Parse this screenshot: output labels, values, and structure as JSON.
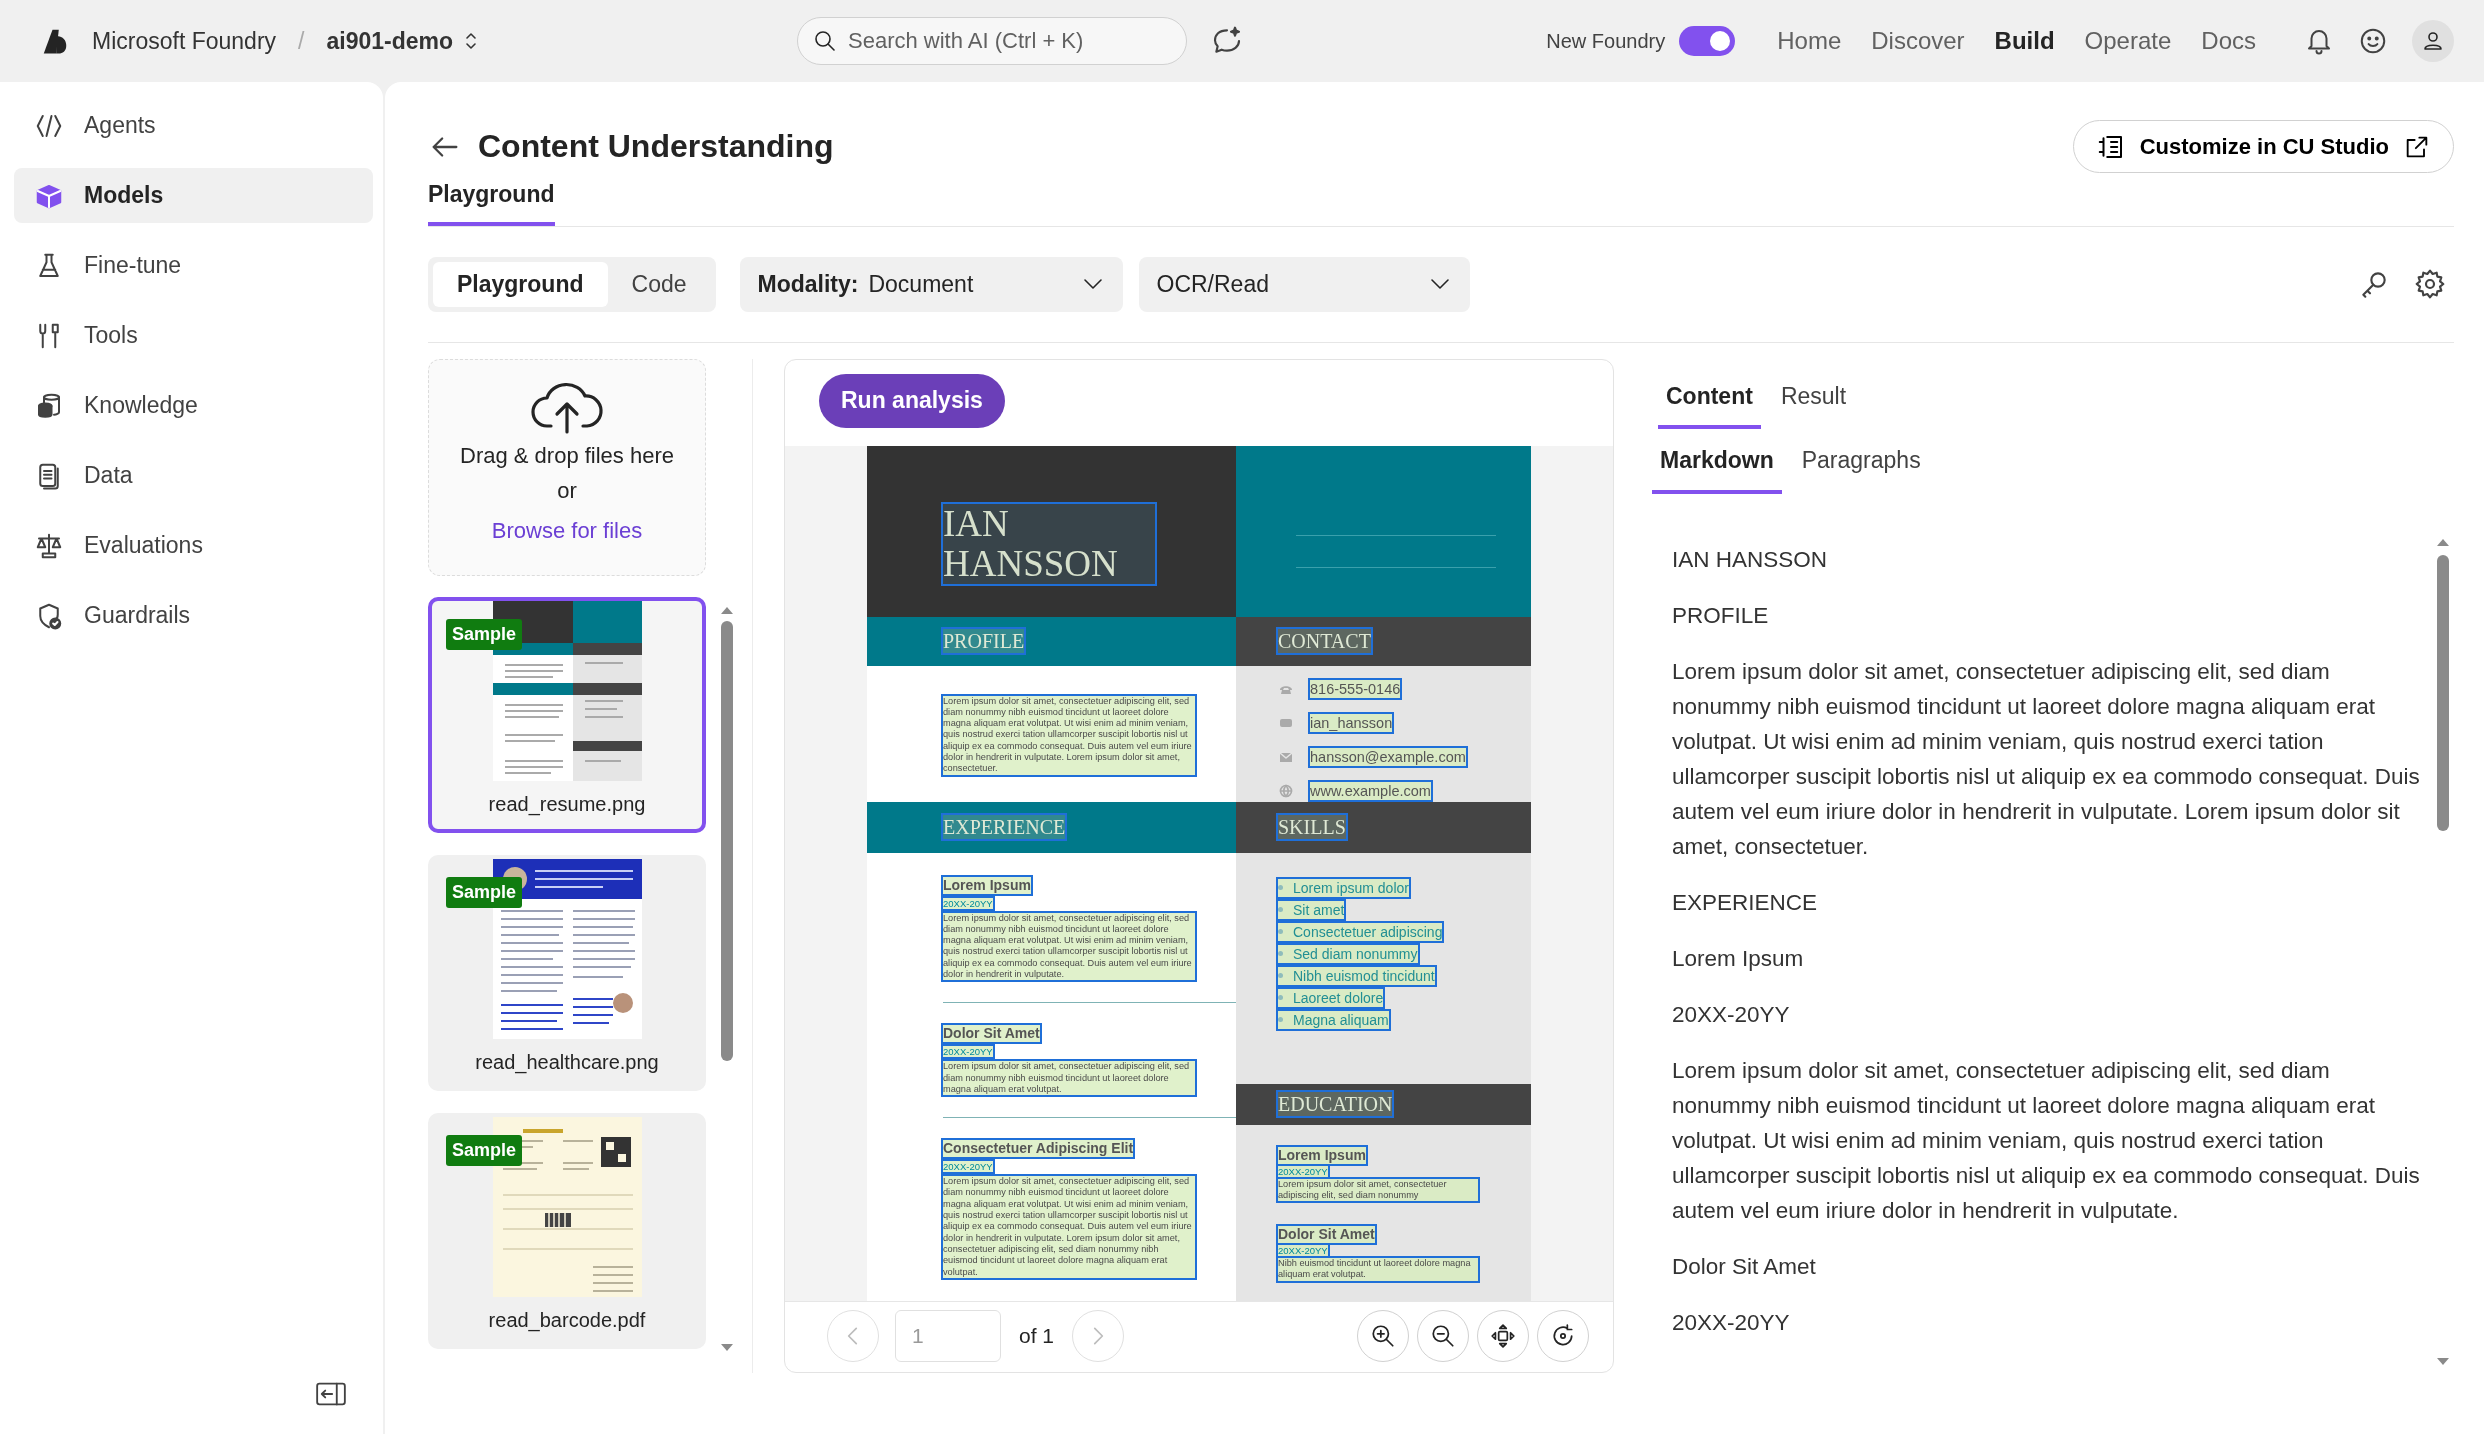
{
  "topbar": {
    "brand": "Microsoft Foundry",
    "separator": "/",
    "project": "ai901-demo",
    "search": {
      "placeholder": "Search with AI (Ctrl + K)"
    },
    "toggle": {
      "label": "New Foundry",
      "on": true
    },
    "nav": [
      {
        "label": "Home",
        "selected": false
      },
      {
        "label": "Discover",
        "selected": false
      },
      {
        "label": "Build",
        "selected": true
      },
      {
        "label": "Operate",
        "selected": false
      },
      {
        "label": "Docs",
        "selected": false
      }
    ]
  },
  "sidebar": {
    "items": [
      {
        "label": "Agents",
        "selected": false
      },
      {
        "label": "Models",
        "selected": true
      },
      {
        "label": "Fine-tune",
        "selected": false
      },
      {
        "label": "Tools",
        "selected": false
      },
      {
        "label": "Knowledge",
        "selected": false
      },
      {
        "label": "Data",
        "selected": false
      },
      {
        "label": "Evaluations",
        "selected": false
      },
      {
        "label": "Guardrails",
        "selected": false
      }
    ]
  },
  "page": {
    "title": "Content Understanding",
    "tabs": [
      {
        "label": "Playground",
        "selected": true
      }
    ],
    "action": "Customize in CU Studio"
  },
  "toolbar": {
    "segments": [
      {
        "label": "Playground",
        "selected": true
      },
      {
        "label": "Code",
        "selected": false
      }
    ],
    "dropdowns": [
      {
        "label": "Modality:",
        "value": "Document"
      },
      {
        "value": "OCR/Read"
      }
    ]
  },
  "files": {
    "upload": {
      "text": "Drag & drop files here",
      "or": "or",
      "link": "Browse for files"
    },
    "items": [
      {
        "name": "read_resume.png",
        "badge": "Sample",
        "selected": true,
        "kind": "resume"
      },
      {
        "name": "read_healthcare.png",
        "badge": "Sample",
        "selected": false,
        "kind": "article"
      },
      {
        "name": "read_barcode.pdf",
        "badge": "Sample",
        "selected": false,
        "kind": "invoice"
      }
    ]
  },
  "preview": {
    "run_button": "Run analysis",
    "pager": {
      "page": "1",
      "of": "of 1"
    },
    "document": {
      "name_lines": [
        "IAN",
        "HANSSON"
      ],
      "profile": {
        "heading": "PROFILE",
        "text": "Lorem ipsum dolor sit amet, consectetuer adipiscing elit, sed diam nonummy nibh euismod tincidunt ut laoreet dolore magna aliquam erat volutpat. Ut wisi enim ad minim veniam, quis nostrud exerci tation ullamcorper suscipit lobortis nisl ut aliquip ex ea commodo consequat. Duis autem vel eum iriure dolor in hendrerit in vulputate. Lorem ipsum dolor sit amet, consectetuer."
      },
      "contact": {
        "heading": "CONTACT",
        "items": [
          "816-555-0146",
          "ian_hansson",
          "hansson@example.com",
          "www.example.com"
        ]
      },
      "experience": {
        "heading": "EXPERIENCE",
        "items": [
          {
            "title": "Lorem Ipsum",
            "dates": "20XX-20YY",
            "text": "Lorem ipsum dolor sit amet, consectetuer adipiscing elit, sed diam nonummy nibh euismod tincidunt ut laoreet dolore magna aliquam erat volutpat. Ut wisi enim ad minim veniam, quis nostrud exerci tation ullamcorper suscipit lobortis nisl ut aliquip ex ea commodo consequat. Duis autem vel eum iriure dolor in hendrerit in vulputate."
          },
          {
            "title": "Dolor Sit Amet",
            "dates": "20XX-20YY",
            "text": "Lorem ipsum dolor sit amet, consectetuer adipiscing elit, sed diam nonummy nibh euismod tincidunt ut laoreet dolore magna aliquam erat volutpat."
          },
          {
            "title": "Consectetuer Adipiscing Elit",
            "dates": "20XX-20YY",
            "text": "Lorem ipsum dolor sit amet, consectetuer adipiscing elit, sed diam nonummy nibh euismod tincidunt ut laoreet dolore magna aliquam erat volutpat. Ut wisi enim ad minim veniam, quis nostrud exerci tation ullamcorper suscipit lobortis nisl ut aliquip ex ea commodo consequat. Duis autem vel eum iriure dolor in hendrerit in vulputate. Lorem ipsum dolor sit amet, consectetuer adipiscing elit, sed diam nonummy nibh euismod tincidunt ut laoreet dolore magna aliquam erat volutpat."
          }
        ]
      },
      "skills": {
        "heading": "SKILLS",
        "items": [
          "Lorem ipsum dolor",
          "Sit amet",
          "Consectetuer adipiscing",
          "Sed diam nonummy",
          "Nibh euismod tincidunt",
          "Laoreet dolore",
          "Magna aliquam"
        ]
      },
      "education": {
        "heading": "EDUCATION",
        "items": [
          {
            "title": "Lorem Ipsum",
            "dates": "20XX-20YY",
            "text": "Lorem ipsum dolor sit amet, consectetuer adipiscing elit, sed diam nonummy"
          },
          {
            "title": "Dolor Sit Amet",
            "dates": "20XX-20YY",
            "text": "Nibh euismod tincidunt ut laoreet dolore magna aliquam erat volutpat."
          }
        ]
      }
    }
  },
  "results": {
    "tabs": [
      {
        "label": "Content",
        "selected": true
      },
      {
        "label": "Result",
        "selected": false
      }
    ],
    "subtabs": [
      {
        "label": "Markdown",
        "selected": true
      },
      {
        "label": "Paragraphs",
        "selected": false
      }
    ],
    "lines": [
      "IAN HANSSON",
      "PROFILE",
      "Lorem ipsum dolor sit amet, consectetuer adipiscing elit, sed diam nonummy nibh euismod tincidunt ut laoreet dolore magna aliquam erat volutpat. Ut wisi enim ad minim veniam, quis nostrud exerci tation ullamcorper suscipit lobortis nisl ut aliquip ex ea commodo consequat. Duis autem vel eum iriure dolor in hendrerit in vulputate. Lorem ipsum dolor sit amet, consectetuer.",
      "EXPERIENCE",
      "Lorem Ipsum",
      "20XX-20YY",
      "Lorem ipsum dolor sit amet, consectetuer adipiscing elit, sed diam nonummy nibh euismod tincidunt ut laoreet dolore magna aliquam erat volutpat. Ut wisi enim ad minim veniam, quis nostrud exerci tation ullamcorper suscipit lobortis nisl ut aliquip ex ea commodo consequat. Duis autem vel eum iriure dolor in hendrerit in vulputate.",
      "Dolor Sit Amet",
      "20XX-20YY"
    ]
  }
}
